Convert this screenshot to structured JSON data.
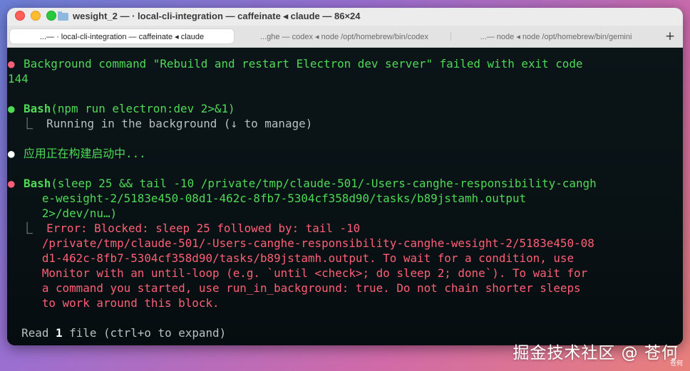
{
  "window": {
    "title": "wesight_2 — · local-cli-integration — caffeinate ◂ claude — 86×24"
  },
  "tabs": [
    {
      "label": "...— · local-cli-integration — caffeinate ◂ claude",
      "active": true
    },
    {
      "label": "...ghe — codex ◂ node /opt/homebrew/bin/codex",
      "active": false
    },
    {
      "label": "...— node ◂ node /opt/homebrew/bin/gemini",
      "active": false
    }
  ],
  "new_tab_label": "+",
  "terminal": {
    "l1_bullet": "●",
    "l1": "Background command \"Rebuild and restart Electron dev server\" failed with exit code",
    "l1b": "144",
    "l2_bullet": "●",
    "l2_cmd": "Bash",
    "l2_args": "(npm run electron:dev 2>&1)",
    "l3": "  ⎿  Running in the background (↓ to manage)",
    "l4_bullet": "●",
    "l4": "应用正在构建启动中...",
    "l5_bullet": "●",
    "l5_cmd": "Bash",
    "l5_args": "(sleep 25 && tail -10 /private/tmp/claude-501/-Users-canghe-responsibility-cangh",
    "l5b": "     e-wesight-2/5183e450-08d1-462c-8fb7-5304cf358d90/tasks/b89jstamh.output",
    "l5c": "     2>/dev/nu…)",
    "l6_prefix": "  ⎿  ",
    "l6": "Error: Blocked: sleep 25 followed by: tail -10",
    "l6b": "     /private/tmp/claude-501/-Users-canghe-responsibility-canghe-wesight-2/5183e450-08",
    "l6c": "     d1-462c-8fb7-5304cf358d90/tasks/b89jstamh.output. To wait for a condition, use",
    "l6d": "     Monitor with an until-loop (e.g. `until <check>; do sleep 2; done`). To wait for",
    "l6e": "     a command you started, use run_in_background: true. Do not chain shorter sleeps",
    "l6f": "     to work around this block.",
    "l7_pre": "  Read ",
    "l7_num": "1",
    "l7_post": " file (ctrl+o to expand)"
  },
  "watermark": "掘金技术社区 @ 苍何",
  "watermark_small": "苍何",
  "colors": {
    "green": "#4fd957",
    "red": "#ff5f76",
    "gray": "#b7c0c5"
  }
}
